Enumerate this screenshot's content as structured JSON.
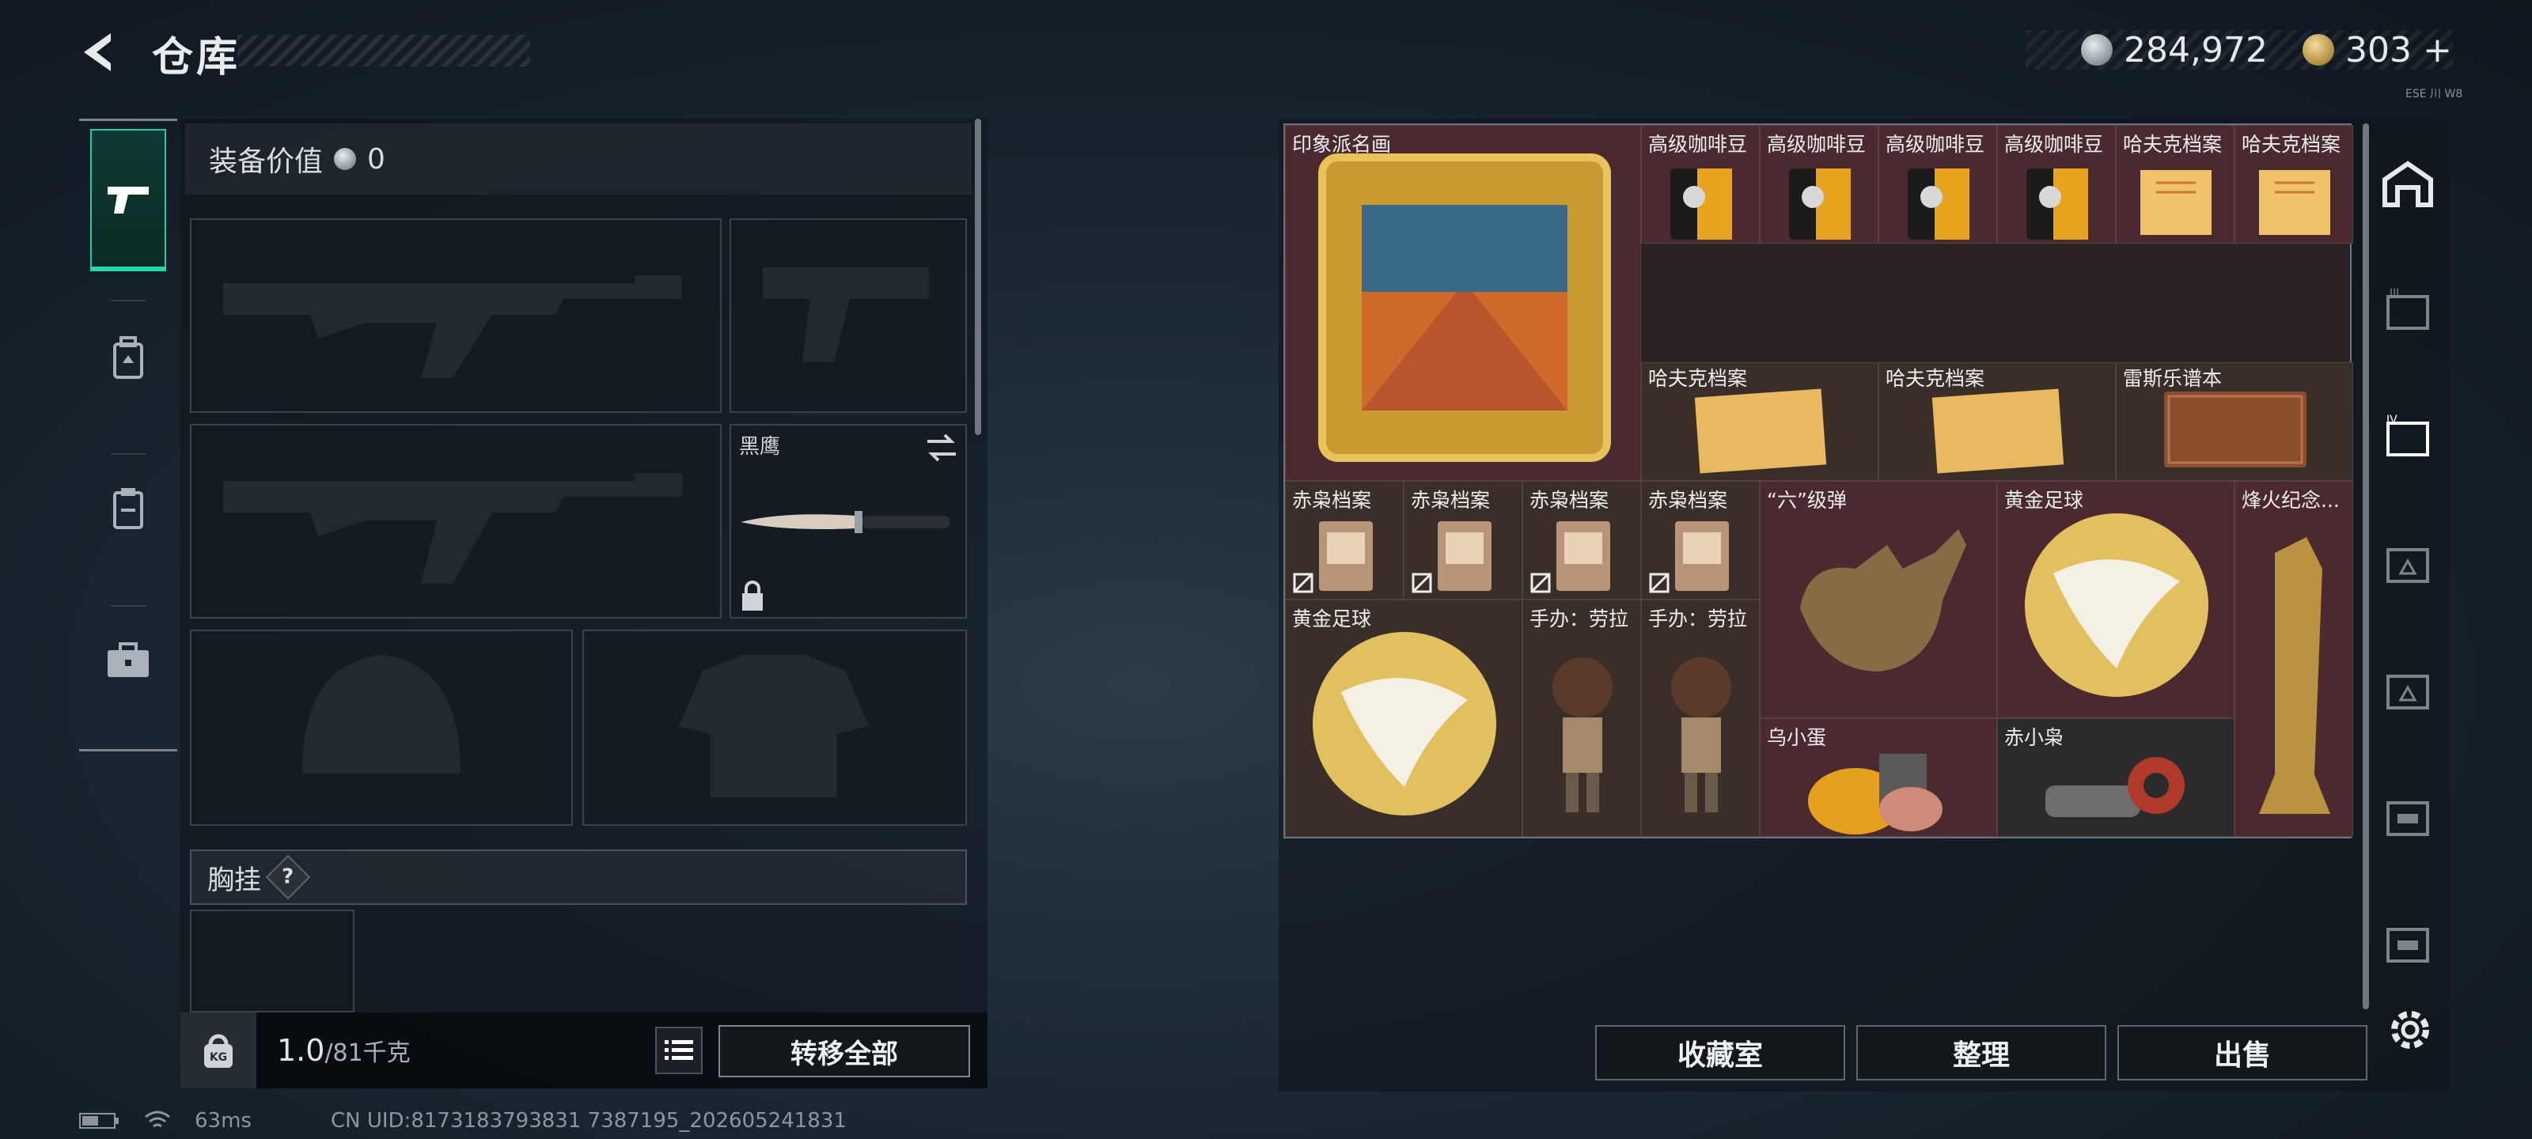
{
  "header": {
    "title": "仓库",
    "silver_amount": "284,972",
    "gold_amount": "303",
    "plus": "+",
    "tiny_text": "ESE 川 W8"
  },
  "equipment": {
    "value_label": "装备价值",
    "value": "0",
    "melee_label": "黑鹰",
    "chest_label": "胸挂",
    "chest_help": "?"
  },
  "weight": {
    "unit_icon_label": "KG",
    "current": "1.0",
    "max": "/81千克",
    "transfer_all": "转移全部"
  },
  "status": {
    "ping": "63ms",
    "uid": "CN UID:8173183793831 7387195_202605241831"
  },
  "inventory": {
    "items": [
      {
        "label": "印象派名画"
      },
      {
        "label": "高级咖啡豆"
      },
      {
        "label": "高级咖啡豆"
      },
      {
        "label": "高级咖啡豆"
      },
      {
        "label": "高级咖啡豆"
      },
      {
        "label": "哈夫克档案"
      },
      {
        "label": "哈夫克档案"
      },
      {
        "label": "哈夫克档案"
      },
      {
        "label": "哈夫克档案"
      },
      {
        "label": "雷斯乐谱本"
      },
      {
        "label": "赤枭档案"
      },
      {
        "label": "赤枭档案"
      },
      {
        "label": "赤枭档案"
      },
      {
        "label": "赤枭档案"
      },
      {
        "label": "“六”级弹"
      },
      {
        "label": "黄金足球"
      },
      {
        "label": "烽火纪念..."
      },
      {
        "label": "黄金足球"
      },
      {
        "label": "手办：劳拉"
      },
      {
        "label": "手办：劳拉"
      },
      {
        "label": "乌小蛋"
      },
      {
        "label": "赤小枭"
      }
    ]
  },
  "actions": {
    "collection": "收藏室",
    "sort": "整理",
    "sell": "出售"
  },
  "colors": {
    "accent_teal": "#26d6ad",
    "cell_red": "#4a2a2e",
    "cell_brown": "#3a2e28",
    "gold": "#d8b24a"
  }
}
